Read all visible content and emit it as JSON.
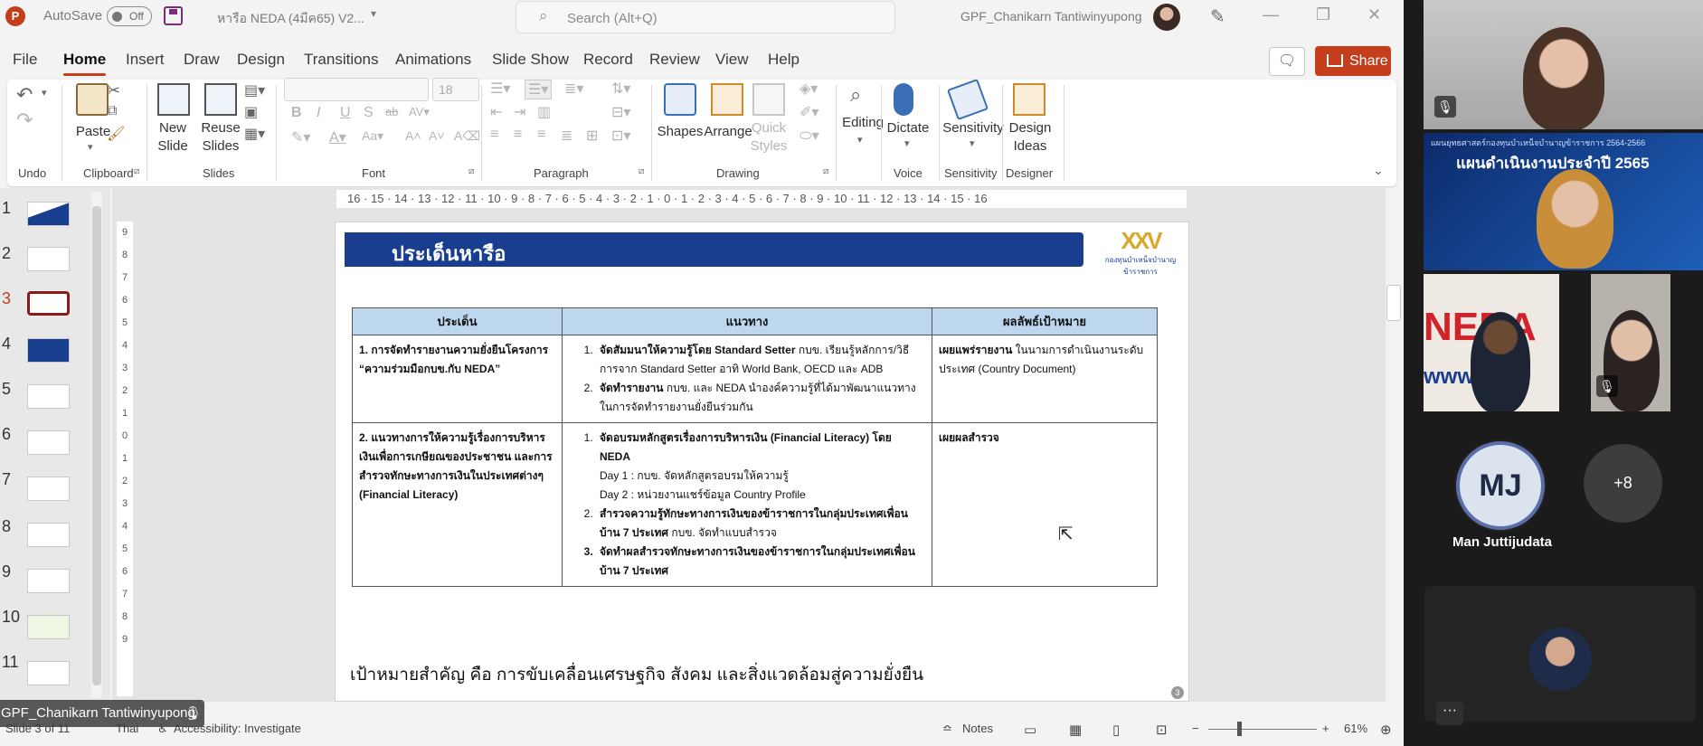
{
  "titlebar": {
    "app_logo": "P",
    "autosave_label": "AutoSave",
    "autosave_state": "Off",
    "document_title": "หารือ NEDA (4มีค65) V2...",
    "search_placeholder": "Search (Alt+Q)",
    "account_name": "GPF_Chanikarn Tantiwinyupong"
  },
  "menu": {
    "items": [
      "File",
      "Home",
      "Insert",
      "Draw",
      "Design",
      "Transitions",
      "Animations",
      "Slide Show",
      "Record",
      "Review",
      "View",
      "Help"
    ],
    "active": "Home",
    "share_label": "Share"
  },
  "ribbon": {
    "groups": {
      "undo": "Undo",
      "clipboard": "Clipboard",
      "slides": "Slides",
      "font": "Font",
      "paragraph": "Paragraph",
      "drawing": "Drawing",
      "voice": "Voice",
      "sensitivity": "Sensitivity",
      "designer": "Designer"
    },
    "buttons": {
      "paste": "Paste",
      "new_slide_1": "New",
      "new_slide_2": "Slide",
      "reuse_1": "Reuse",
      "reuse_2": "Slides",
      "shapes": "Shapes",
      "arrange": "Arrange",
      "quick_styles_1": "Quick",
      "quick_styles_2": "Styles",
      "editing": "Editing",
      "dictate": "Dictate",
      "sensitivity": "Sensitivity",
      "design_ideas_1": "Design",
      "design_ideas_2": "Ideas"
    },
    "font_size_value": "18"
  },
  "thumbnails": {
    "numbers": [
      "1",
      "2",
      "3",
      "4",
      "5",
      "6",
      "7",
      "8",
      "9",
      "10",
      "11"
    ],
    "selected": "3"
  },
  "ruler": {
    "horizontal": "16 · 15 · 14 · 13 · 12 · 11 · 10 · 9 · 8 · 7 · 6 · 5 · 4 · 3 · 2 · 1 · 0 · 1 · 2 · 3 · 4 · 5 · 6 · 7 · 8 · 9 · 10 · 11 · 12 · 13 · 14 · 15 · 16",
    "vertical": [
      "9",
      "8",
      "7",
      "6",
      "5",
      "4",
      "3",
      "2",
      "1",
      "0",
      "1",
      "2",
      "3",
      "4",
      "5",
      "6",
      "7",
      "8",
      "9"
    ]
  },
  "slide": {
    "heading": "ประเด็นหารือ",
    "logo_text": "กองทุนบำเหน็จบำนาญข้าราชการ",
    "table": {
      "headers": [
        "ประเด็น",
        "แนวทาง",
        "ผลลัพธ์เป้าหมาย"
      ],
      "row1": {
        "issue_1": "1. การจัดทำรายงานความยั่งยืนโครงการ",
        "issue_2": "“ความร่วมมือกบข.กับ NEDA”",
        "items": [
          {
            "bold": "จัดสัมมนาให้ความรู้โดย Standard Setter",
            "text": " กบข. เรียนรู้หลักการ/วิธีการจาก Standard Setter อาทิ World Bank, OECD และ ADB"
          },
          {
            "bold": "จัดทำรายงาน",
            "text": " กบข. และ NEDA นำองค์ความรู้ที่ได้มาพัฒนาแนวทางในการจัดทำรายงานยั่งยืนร่วมกัน"
          }
        ],
        "result_bold": "เผยแพร่รายงาน",
        "result_text": " ในนามการดำเนินงานระดับประเทศ (Country Document)"
      },
      "row2": {
        "issue": "2. แนวทางการให้ความรู้เรื่องการบริหารเงินเพื่อการเกษียณของประชาชน และการสำรวจทักษะทางการเงินในประเทศต่างๆ (Financial Literacy)",
        "item1": "จัดอบรมหลักสูตรเรื่องการบริหารเงิน (Financial Literacy) โดย NEDA",
        "day1": "Day 1 : กบข. จัดหลักสูตรอบรมให้ความรู้",
        "day2": "Day 2 : หน่วยงานแชร์ข้อมูล Country Profile",
        "item2_bold": "สำรวจความรู้ทักษะทางการเงินของข้าราชการในกลุ่มประเทศเพื่อนบ้าน 7 ประเทศ",
        "item2_text": " กบข. จัดทำแบบสำรวจ",
        "item3": "จัดทำผลสำรวจทักษะทางการเงินของข้าราชการในกลุ่มประเทศเพื่อนบ้าน 7 ประเทศ",
        "result": "เผยผลสำรวจ"
      }
    },
    "footer": "เป้าหมายสำคัญ คือ การขับเคลื่อนเศรษฐกิจ สังคม และสิ่งแวดล้อมสู่ความยั่งยืน",
    "number": "3"
  },
  "status": {
    "slide_info": "Slide 3 of 11",
    "language": "Thai",
    "accessibility": "Accessibility: Investigate",
    "notes": "Notes",
    "zoom": "61%"
  },
  "meeting": {
    "presenter_name": "GPF_Chanikarn Tantiwinyupong",
    "shared_title": "แผนดำเนินงานประจำปี 2565",
    "shared_subtitle": "แผนยุทธศาสตร์กองทุนบำเหน็จบำนาญข้าราชการ 2564-2566",
    "neda_sign": "NEDA",
    "neda_sub": "www",
    "participant_initials": "MJ",
    "participant_name": "Man Juttijudata",
    "more_count": "+8",
    "more_menu": "···"
  },
  "colors": {
    "accent": "#c43e1c",
    "slide_banner": "#1a3e8f",
    "table_header": "#bcd7ee"
  }
}
